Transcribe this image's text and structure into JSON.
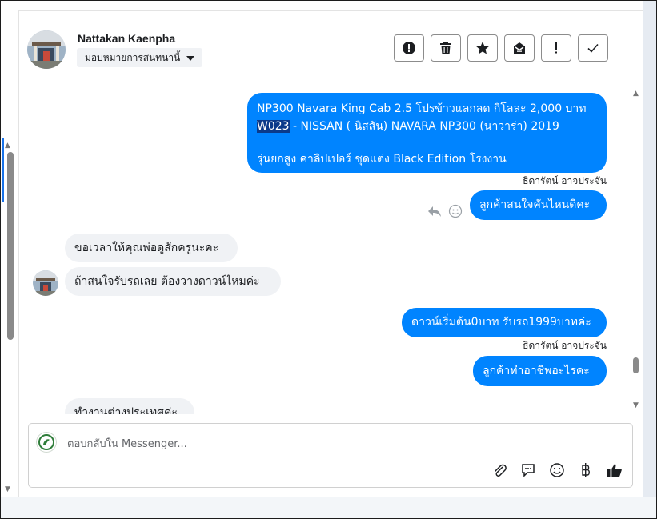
{
  "header": {
    "contact_name": "Nattakan Kaenpha",
    "assign_label": "มอบหมายการสนทนานี้",
    "actions": [
      "alert-circle-icon",
      "trash-icon",
      "star-icon",
      "envelope-icon",
      "exclamation-icon",
      "check-icon"
    ]
  },
  "messages": {
    "m1_line1": "NP300 Navara King Cab 2.5 โปรข้าวแลกลด กิโลละ 2,000 บาท",
    "m1_line2_highlight": "W023",
    "m1_line2_rest": " - NISSAN ( นิสสัน) NAVARA NP300 (นาวาร่า) 2019",
    "m1_line3": " รุ่นยกสูง คาลิปเปอร์ ชุดแต่ง Black Edition โรงงาน",
    "m1_sender": "ธิดารัตน์ อาจประจัน",
    "m2": "ลูกค้าสนใจคันไหนดีคะ",
    "m3": "ขอเวลาให้คุณพ่อดูสักครู่นะคะ",
    "m4": "ถ้าสนใจรับรถเลย ต้องวางดาวน์ไหมค่ะ",
    "m5": "ดาวน์เริ่มต้น0บาท รับรถ1999บาทค่ะ",
    "m5_sender": "ธิดารัตน์ อาจประจัน",
    "m6": "ลูกค้าทำอาชีพอะไรคะ",
    "m7_partial": "ทำงานต่างประเทศค่ะ"
  },
  "composer": {
    "placeholder": "ตอบกลับใน Messenger...",
    "tools": [
      "paperclip-icon",
      "speech-bubble-icon",
      "emoji-icon",
      "baht-icon",
      "thumbs-up-icon"
    ]
  },
  "colors": {
    "outgoing": "#0084ff",
    "incoming": "#f0f2f5",
    "selection": "#0b3a8a"
  }
}
